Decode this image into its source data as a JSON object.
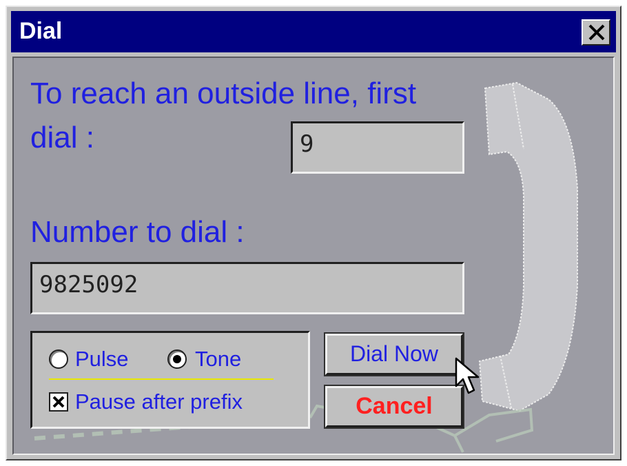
{
  "window": {
    "title": "Dial"
  },
  "titlebar": {
    "close_icon": "close-x-icon"
  },
  "prefix": {
    "label": "To reach an outside line, first dial :",
    "value": "9"
  },
  "number": {
    "label": "Number to dial :",
    "value": "9825092"
  },
  "options": {
    "pulse_label": "Pulse",
    "tone_label": "Tone",
    "selected": "Tone",
    "pause_label": "Pause after prefix",
    "pause_checked": true
  },
  "buttons": {
    "dial_now": "Dial Now",
    "cancel": "Cancel"
  },
  "colors": {
    "title_bg": "#000080",
    "label_blue": "#2020e0",
    "cancel_red": "#ff2020",
    "client_bg": "#9c9ca4"
  },
  "icons": {
    "phone": "phone-handset-icon",
    "cursor": "mouse-pointer-icon"
  }
}
